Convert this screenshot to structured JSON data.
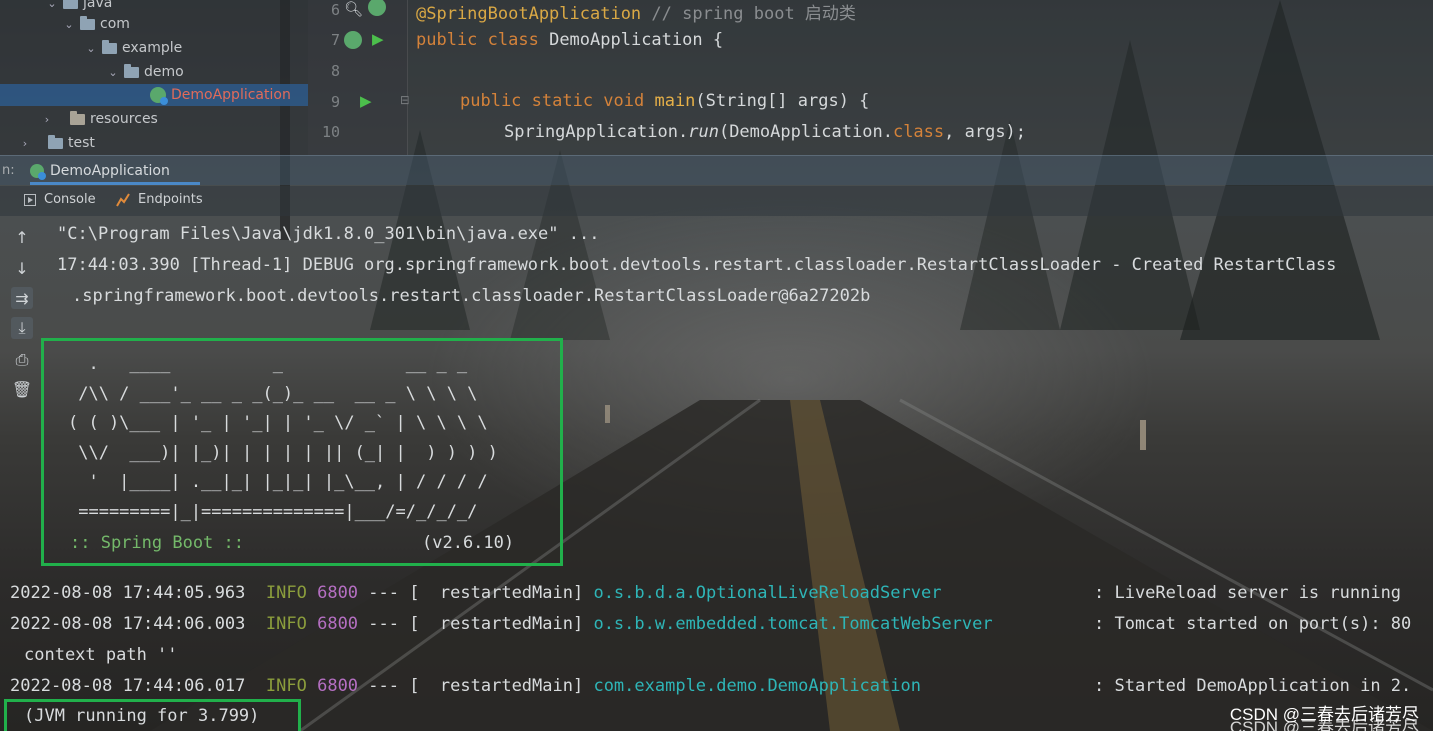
{
  "project_tree": {
    "items": [
      {
        "label": "java",
        "type": "folder"
      },
      {
        "label": "com",
        "type": "package"
      },
      {
        "label": "example",
        "type": "package"
      },
      {
        "label": "demo",
        "type": "package"
      },
      {
        "label": "DemoApplication",
        "type": "class",
        "selected": true
      },
      {
        "label": "resources",
        "type": "folder"
      },
      {
        "label": "test",
        "type": "folder"
      }
    ]
  },
  "editor": {
    "line_numbers": [
      "6",
      "7",
      "8",
      "9",
      "10"
    ],
    "lines": {
      "l6_annotation": "@SpringBootApplication",
      "l6_comment": " // spring boot 启动类",
      "l7_kw1": "public",
      "l7_kw2": " class",
      "l7_rest": " DemoApplication {",
      "l9_kw": "public static void",
      "l9_fn": " main",
      "l9_rest": "(String[] args) {",
      "l10_a": "SpringApplication.",
      "l10_run": "run",
      "l10_b": "(DemoApplication.",
      "l10_class": "class",
      "l10_c": ", args);"
    }
  },
  "run_window": {
    "prefix": "n:",
    "tab_label": "DemoApplication",
    "subtabs": [
      "Console",
      "Endpoints"
    ]
  },
  "console": {
    "line1": "\"C:\\Program Files\\Java\\jdk1.8.0_301\\bin\\java.exe\" ...",
    "line2": "17:44:03.390 [Thread-1] DEBUG org.springframework.boot.devtools.restart.classloader.RestartClassLoader - Created RestartClass",
    "line3": ".springframework.boot.devtools.restart.classloader.RestartClassLoader@6a27202b",
    "banner_art": "  .   ____          _            __ _ _\n /\\\\ / ___'_ __ _ _(_)_ __  __ _ \\ \\ \\ \\\n( ( )\\___ | '_ | '_| | '_ \\/ _` | \\ \\ \\ \\\n \\\\/  ___)| |_)| | | | | || (_| |  ) ) ) )\n  '  |____| .__|_| |_|_| |_\\__, | / / / /\n =========|_|==============|___/=/_/_/_/",
    "spring_boot_label": ":: Spring Boot ::",
    "spring_boot_version": "(v2.6.10)",
    "logs": [
      {
        "ts": "2022-08-08 17:44:05.963",
        "level": "INFO",
        "pid": "6800",
        "sep": " --- [  restartedMain] ",
        "logger": "o.s.b.d.a.OptionalLiveReloadServer",
        "msg": ": LiveReload server is running"
      },
      {
        "ts": "2022-08-08 17:44:06.003",
        "level": "INFO",
        "pid": "6800",
        "sep": " --- [  restartedMain] ",
        "logger": "o.s.b.w.embedded.tomcat.TomcatWebServer",
        "msg": ": Tomcat started on port(s): 80"
      },
      {
        "ts": "2022-08-08 17:44:06.017",
        "level": "INFO",
        "pid": "6800",
        "sep": " --- [  restartedMain] ",
        "logger": "com.example.demo.DemoApplication",
        "msg": ": Started DemoApplication in 2."
      }
    ],
    "continuation_context": "context path ''",
    "jvm_line": "(JVM running for 3.799)"
  },
  "watermark": {
    "line1": "CSDN @三春去后诸芳尽",
    "line2": "CSDN @三春去后诸芳尽"
  },
  "colors": {
    "highlight_box": "#21b04b",
    "log_info": "#8b9d3c",
    "log_pid": "#b56fc2",
    "logger": "#2eb5b7",
    "selection": "#2d5f96"
  }
}
